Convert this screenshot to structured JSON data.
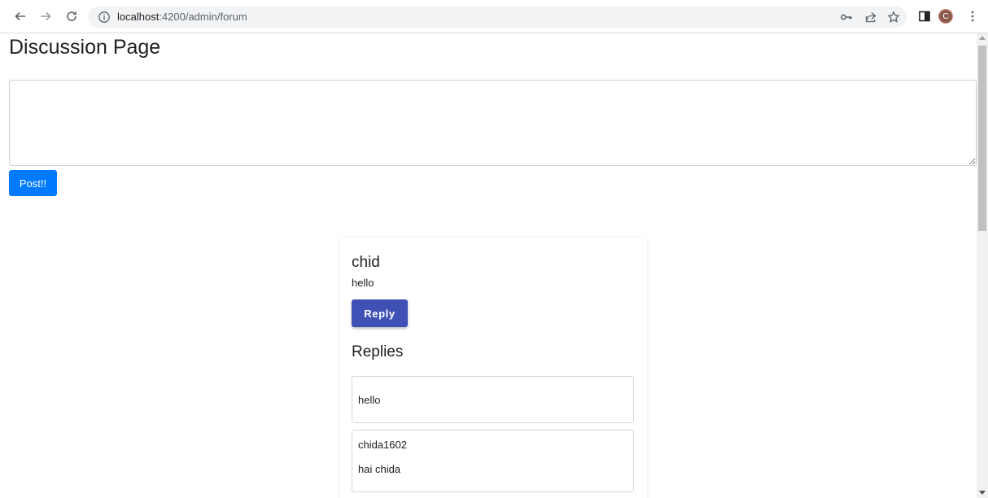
{
  "browser": {
    "url_host": "localhost",
    "url_rest": ":4200/admin/forum",
    "avatar_letter": "C",
    "icons": [
      "back-icon",
      "forward-icon",
      "reload-icon",
      "info-icon",
      "key-icon",
      "share-icon",
      "star-icon",
      "side-panel-icon",
      "kebab-menu-icon"
    ]
  },
  "page": {
    "title": "Discussion Page",
    "post_placeholder": "",
    "post_label": "Post!!"
  },
  "post": {
    "author": "chid",
    "message": "hello",
    "reply_label": "Reply",
    "replies_title": "Replies",
    "replies": [
      {
        "user": "",
        "text": "hello"
      },
      {
        "user": "chida1602",
        "text": "hai chida"
      }
    ]
  },
  "colors": {
    "post_button": "#007bff",
    "reply_button": "#3f51b5",
    "avatar": "#8d5b4c"
  }
}
